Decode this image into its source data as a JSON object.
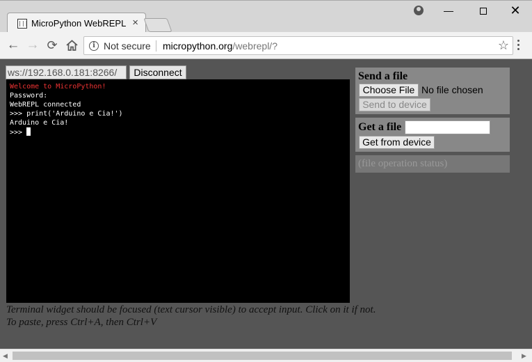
{
  "browser": {
    "tab_title": "MicroPython WebREPL",
    "tab_close": "×",
    "window_controls": {
      "minimize": "—",
      "close": "✕"
    },
    "nav": {
      "back": "←",
      "forward": "→",
      "reload": "⟳"
    },
    "omnibox": {
      "security_label": "Not secure",
      "url_host": "micropython.org",
      "url_path": "/webrepl/?",
      "info_icon": "i",
      "bookmark_icon": "☆"
    }
  },
  "connection": {
    "ws_url": "ws://192.168.0.181:8266/",
    "disconnect_label": "Disconnect"
  },
  "terminal": {
    "lines": [
      "Welcome to MicroPython!",
      "Password:",
      "WebREPL connected",
      ">>> print('Arduino e Cia!')",
      "Arduino e Cia!",
      ">>> "
    ],
    "colors": {
      "welcome": "#ee3333",
      "text": "#ffffff",
      "background": "#000000"
    }
  },
  "hints": {
    "line1": "Terminal widget should be focused (text cursor visible) to accept input. Click on it if not.",
    "line2": "To paste, press Ctrl+A, then Ctrl+V"
  },
  "send_file": {
    "title": "Send a file",
    "choose_label": "Choose File",
    "no_file_label": "No file chosen",
    "send_label": "Send to device"
  },
  "get_file": {
    "title": "Get a file",
    "input_value": "",
    "get_label": "Get from device"
  },
  "file_status": "(file operation status)",
  "scrollbar": {
    "left_arrow": "◀",
    "right_arrow": "▶"
  }
}
